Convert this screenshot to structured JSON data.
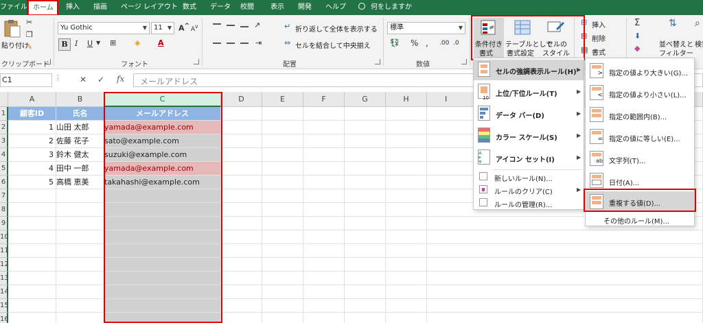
{
  "tabs": [
    "ファイル",
    "ホーム",
    "挿入",
    "描画",
    "ページ レイアウト",
    "数式",
    "データ",
    "校閲",
    "表示",
    "開発",
    "ヘルプ"
  ],
  "tell_me": "何をしますか",
  "ribbon": {
    "clipboard": {
      "paste": "貼り付け",
      "group": "クリップボード"
    },
    "font": {
      "name": "Yu Gothic",
      "size": "11",
      "bold": "B",
      "italic": "I",
      "underline": "U",
      "grow": "A",
      "shrink": "A",
      "fontcolor": "A",
      "group": "フォント"
    },
    "alignment": {
      "wrap": "折り返して全体を表示する",
      "merge": "セルを結合して中央揃え",
      "group": "配置"
    },
    "number": {
      "format": "標準",
      "percent": "%",
      "group": "数値"
    },
    "styles": {
      "conditional1": "条件付き",
      "conditional2": "書式",
      "table1": "テーブルとして",
      "table2": "書式設定",
      "cell1": "セルの",
      "cell2": "スタイル"
    },
    "cells": {
      "insert": "挿入",
      "delete": "削除",
      "format": "書式"
    },
    "editing": {
      "sigma": "Σ",
      "sort1": "並べ替えと",
      "sort2": "フィルター",
      "find": "検索と選択"
    }
  },
  "formula_bar": {
    "namebox": "C1",
    "cancel": "✕",
    "enter": "✓",
    "fx": "fx",
    "value": "メールアドレス"
  },
  "grid": {
    "columns": [
      "A",
      "B",
      "C",
      "D",
      "E",
      "F",
      "G",
      "H",
      "I"
    ],
    "rows": [
      "1",
      "2",
      "3",
      "4",
      "5",
      "6",
      "7",
      "8",
      "9",
      "10",
      "11",
      "12",
      "13",
      "14",
      "15",
      "16"
    ],
    "headers": [
      "顧客ID",
      "氏名",
      "メールアドレス"
    ],
    "data": [
      {
        "id": "1",
        "name": "山田 太郎",
        "email": "yamada@example.com",
        "dup": true
      },
      {
        "id": "2",
        "name": "佐藤 花子",
        "email": "sato@example.com",
        "dup": false
      },
      {
        "id": "3",
        "name": "鈴木 健太",
        "email": "suzuki@example.com",
        "dup": false
      },
      {
        "id": "4",
        "name": "田中 一郎",
        "email": "yamada@example.com",
        "dup": true
      },
      {
        "id": "5",
        "name": "高橋 恵美",
        "email": "takahashi@example.com",
        "dup": false
      }
    ]
  },
  "cf_menu": [
    "セルの強調表示ルール(H)",
    "上位/下位ルール(T)",
    "データ バー(D)",
    "カラー スケール(S)",
    "アイコン セット(I)",
    "新しいルール(N)...",
    "ルールのクリア(C)",
    "ルールの管理(R)..."
  ],
  "sub_menu": [
    "指定の値より大きい(G)...",
    "指定の値より小さい(L)...",
    "指定の範囲内(B)...",
    "指定の値に等しい(E)...",
    "文字列(T)...",
    "日付(A)...",
    "重複する値(D)...",
    "その他のルール(M)..."
  ],
  "colors": {
    "excel_green": "#217346",
    "header_blue": "#8db4e2",
    "dup_fill": "#e6b8b7",
    "dup_text": "#9c0006",
    "highlight_red": "#e00000"
  }
}
